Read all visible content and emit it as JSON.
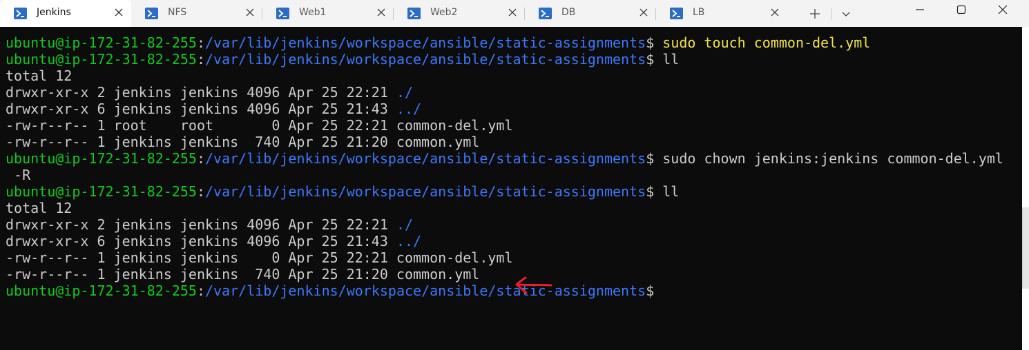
{
  "tabs": [
    {
      "label": "Jenkins",
      "active": true
    },
    {
      "label": "NFS",
      "active": false
    },
    {
      "label": "Web1",
      "active": false
    },
    {
      "label": "Web2",
      "active": false
    },
    {
      "label": "DB",
      "active": false
    },
    {
      "label": "LB",
      "active": false
    }
  ],
  "colors": {
    "prompt_user": "#13c81e",
    "prompt_path": "#3b78ff",
    "text": "#cccccc",
    "command": "#f4e34a",
    "background": "#0c0c0c",
    "annotation_arrow": "#e8202a"
  },
  "icons": {
    "tab": "powershell-icon",
    "close": "close-icon",
    "new_tab": "plus-icon",
    "dropdown": "chevron-down-icon",
    "minimize": "minimize-icon",
    "maximize": "maximize-icon",
    "window_close": "window-close-icon"
  },
  "terminal": {
    "lines": [
      {
        "segments": [
          {
            "t": "ubuntu@ip-172-31-82-255",
            "c": "user"
          },
          {
            "t": ":",
            "c": "plain"
          },
          {
            "t": "/var/lib/jenkins/workspace/ansible/static-assignments",
            "c": "path"
          },
          {
            "t": "$ ",
            "c": "plain"
          },
          {
            "t": "sudo touch common-del.yml",
            "c": "cmd"
          }
        ]
      },
      {
        "segments": [
          {
            "t": "ubuntu@ip-172-31-82-255",
            "c": "user"
          },
          {
            "t": ":",
            "c": "plain"
          },
          {
            "t": "/var/lib/jenkins/workspace/ansible/static-assignments",
            "c": "path"
          },
          {
            "t": "$ ll",
            "c": "plain"
          }
        ]
      },
      {
        "segments": [
          {
            "t": "total 12",
            "c": "plain"
          }
        ]
      },
      {
        "segments": [
          {
            "t": "drwxr-xr-x 2 jenkins jenkins 4096 Apr 25 22:21 ",
            "c": "plain"
          },
          {
            "t": "./",
            "c": "dir"
          }
        ]
      },
      {
        "segments": [
          {
            "t": "drwxr-xr-x 6 jenkins jenkins 4096 Apr 25 21:43 ",
            "c": "plain"
          },
          {
            "t": "../",
            "c": "dir"
          }
        ]
      },
      {
        "segments": [
          {
            "t": "-rw-r--r-- 1 root    root       0 Apr 25 22:21 common-del.yml",
            "c": "plain"
          }
        ]
      },
      {
        "segments": [
          {
            "t": "-rw-r--r-- 1 jenkins jenkins  740 Apr 25 21:20 common.yml",
            "c": "plain"
          }
        ]
      },
      {
        "segments": [
          {
            "t": "ubuntu@ip-172-31-82-255",
            "c": "user"
          },
          {
            "t": ":",
            "c": "plain"
          },
          {
            "t": "/var/lib/jenkins/workspace/ansible/static-assignments",
            "c": "path"
          },
          {
            "t": "$ sudo chown jenkins:jenkins common-del.yml",
            "c": "plain"
          }
        ]
      },
      {
        "segments": [
          {
            "t": " -R",
            "c": "plain"
          }
        ]
      },
      {
        "segments": [
          {
            "t": "ubuntu@ip-172-31-82-255",
            "c": "user"
          },
          {
            "t": ":",
            "c": "plain"
          },
          {
            "t": "/var/lib/jenkins/workspace/ansible/static-assignments",
            "c": "path"
          },
          {
            "t": "$ ll",
            "c": "plain"
          }
        ]
      },
      {
        "segments": [
          {
            "t": "total 12",
            "c": "plain"
          }
        ]
      },
      {
        "segments": [
          {
            "t": "drwxr-xr-x 2 jenkins jenkins 4096 Apr 25 22:21 ",
            "c": "plain"
          },
          {
            "t": "./",
            "c": "dir"
          }
        ]
      },
      {
        "segments": [
          {
            "t": "drwxr-xr-x 6 jenkins jenkins 4096 Apr 25 21:43 ",
            "c": "plain"
          },
          {
            "t": "../",
            "c": "dir"
          }
        ]
      },
      {
        "segments": [
          {
            "t": "-rw-r--r-- 1 jenkins jenkins    0 Apr 25 22:21 common-del.yml",
            "c": "plain"
          }
        ]
      },
      {
        "segments": [
          {
            "t": "-rw-r--r-- 1 jenkins jenkins  740 Apr 25 21:20 common.yml",
            "c": "plain"
          }
        ]
      },
      {
        "segments": [
          {
            "t": "ubuntu@ip-172-31-82-255",
            "c": "user"
          },
          {
            "t": ":",
            "c": "plain"
          },
          {
            "t": "/var/lib/jenkins/workspace/ansible/static-assignments",
            "c": "path"
          },
          {
            "t": "$",
            "c": "plain"
          }
        ]
      }
    ]
  }
}
